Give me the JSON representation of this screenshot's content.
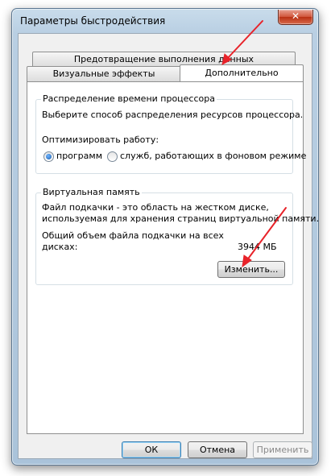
{
  "window": {
    "title": "Параметры быстродействия",
    "close_glyph": "✕"
  },
  "tabs": [
    {
      "label": "Предотвращение выполнения данных"
    },
    {
      "label": "Визуальные эффекты"
    },
    {
      "label": "Дополнительно",
      "active": true
    }
  ],
  "cpu": {
    "title": "Распределение времени процессора",
    "description": "Выберите способ распределения ресурсов процессора.",
    "optimize_label": "Оптимизировать работу:",
    "option_programs": "программ",
    "option_services": "служб, работающих в фоновом режиме",
    "selected": "программ"
  },
  "vm": {
    "title": "Виртуальная память",
    "desc_line1": "Файл подкачки - это область на жестком диске,",
    "desc_line2": "используемая для хранения страниц виртуальной памяти.",
    "total_line1": "Общий объем файла подкачки на всех",
    "total_line2": "дисках:",
    "total_value": "3944 МБ",
    "change_button": "Изменить..."
  },
  "footer": {
    "ok": "ОК",
    "cancel": "Отмена",
    "apply": "Применить"
  },
  "colors": {
    "annotation_arrow": "#e8232a",
    "selected_radio": "#1c5fae"
  }
}
